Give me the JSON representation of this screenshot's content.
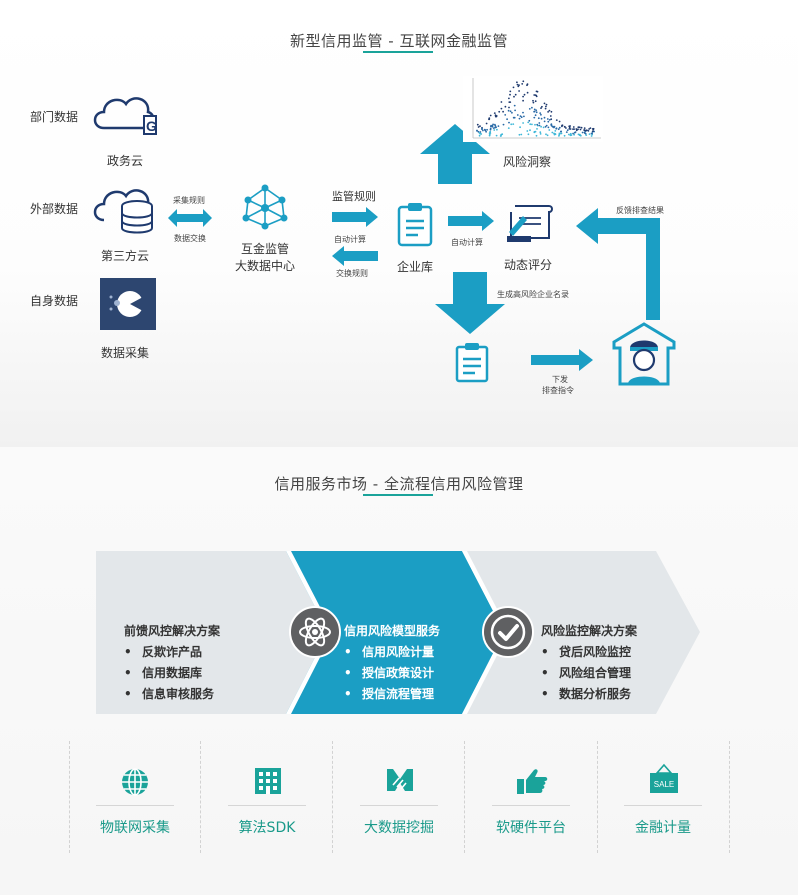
{
  "section1": {
    "title": "新型信用监管 - 互联网金融监管"
  },
  "sources": [
    {
      "side_label": "部门数据",
      "name": "政务云"
    },
    {
      "side_label": "外部数据",
      "name": "第三方云"
    },
    {
      "side_label": "自身数据",
      "name": "数据采集"
    }
  ],
  "arrows": {
    "collect_rules": "采集规则",
    "data_exchange": "数据交换",
    "regulation_rules": "监管规则",
    "auto_calc_1": "自动计算",
    "exchange_rules": "交换规则",
    "auto_calc_2": "自动计算",
    "gen_list": "生成高风险企业名录",
    "issue_line1": "下发",
    "issue_line2": "排查指令",
    "feedback": "反馈排查结果"
  },
  "nodes": {
    "center_line1": "互金监管",
    "center_line2": "大数据中心",
    "enterprise_db": "企业库",
    "risk_insight": "风险洞察",
    "dynamic_score": "动态评分"
  },
  "section2": {
    "title": "信用服务市场 - 全流程信用风险管理"
  },
  "services": [
    {
      "heading": "前馈风控解决方案",
      "items": [
        "反欺诈产品",
        "信用数据库",
        "信息审核服务"
      ]
    },
    {
      "heading": "信用风险模型服务",
      "items": [
        "信用风险计量",
        "授信政策设计",
        "授信流程管理"
      ]
    },
    {
      "heading": "风险监控解决方案",
      "items": [
        "贷后风险监控",
        "风险组合管理",
        "数据分析服务"
      ]
    }
  ],
  "capabilities": [
    {
      "label": "物联网采集",
      "icon": "globe-icon"
    },
    {
      "label": "算法SDK",
      "icon": "building-icon"
    },
    {
      "label": "大数据挖掘",
      "icon": "handshake-icon"
    },
    {
      "label": "软硬件平台",
      "icon": "hand-icon"
    },
    {
      "label": "金融计量",
      "icon": "sale-tag-icon"
    }
  ],
  "colors": {
    "accent": "#1b9ec4",
    "teal": "#1aa39a",
    "navy": "#1f3a6e",
    "chevron_grey": "#e3e7ea",
    "chevron_blue": "#1b9ec4"
  }
}
